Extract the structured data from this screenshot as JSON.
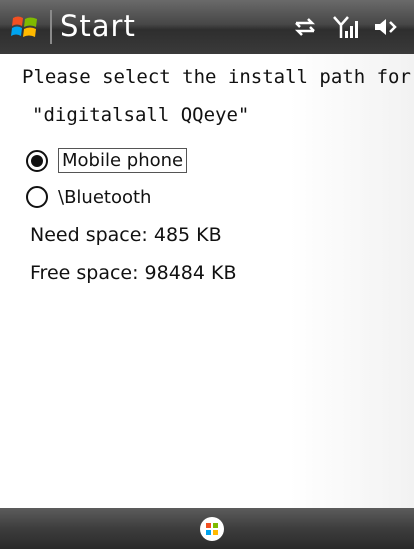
{
  "titlebar": {
    "title": "Start",
    "icons": [
      "windows-logo-icon",
      "sync-icon",
      "signal-icon",
      "volume-icon"
    ]
  },
  "content": {
    "prompt_line1": "Please select the install path for:",
    "prompt_line2": "\"digitalsall QQeye\"",
    "options": [
      {
        "label": "Mobile phone",
        "selected": true
      },
      {
        "label": "\\Bluetooth",
        "selected": false
      }
    ],
    "need_space": "Need space: 485 KB",
    "free_space": "Free space: 98484 KB"
  },
  "bottombar": {
    "icons": [
      "start-button-icon"
    ]
  },
  "colors": {
    "titlebar": "#474747",
    "text": "#111111",
    "background": "#ffffff"
  }
}
